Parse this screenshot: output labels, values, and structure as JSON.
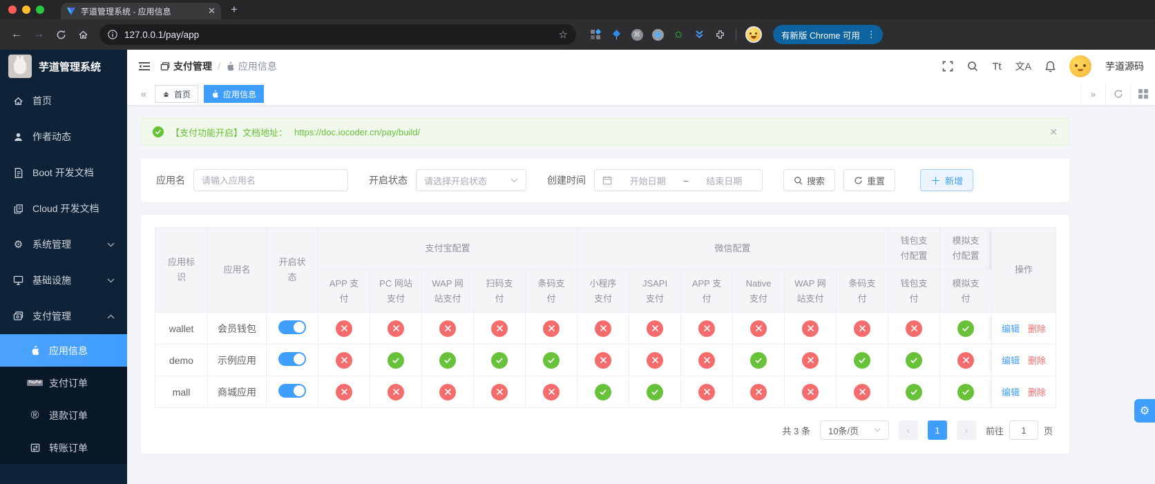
{
  "colors": {
    "accent": "#409eff",
    "success": "#67c23a",
    "danger": "#f56c6c",
    "sidebar_bg": "#0e2238",
    "alert_green_bg": "#f0f9eb"
  },
  "browser": {
    "tab_title": "芋道管理系统 - 应用信息",
    "url": "127.0.0.1/pay/app",
    "update_button": "有新版 Chrome 可用"
  },
  "sidebar": {
    "logo_title": "芋道管理系统",
    "items": [
      {
        "label": "首页"
      },
      {
        "label": "作者动态"
      },
      {
        "label": "Boot 开发文档"
      },
      {
        "label": "Cloud 开发文档"
      },
      {
        "label": "系统管理"
      },
      {
        "label": "基础设施"
      },
      {
        "label": "支付管理"
      }
    ],
    "subitems": [
      {
        "label": "应用信息"
      },
      {
        "label": "支付订单"
      },
      {
        "label": "退款订单"
      },
      {
        "label": "转账订单"
      }
    ]
  },
  "header": {
    "breadcrumb_parent": "支付管理",
    "breadcrumb_current": "应用信息",
    "font_size_icon": "Tt",
    "translate_icon": "文A",
    "user_name": "芋道源码"
  },
  "tabs": {
    "home": "首页",
    "current": "应用信息"
  },
  "alert": {
    "text": "【支付功能开启】文档地址：",
    "link": "https://doc.iocoder.cn/pay/build/"
  },
  "filters": {
    "app_name_label": "应用名",
    "app_name_placeholder": "请输入应用名",
    "status_label": "开启状态",
    "status_placeholder": "请选择开启状态",
    "date_label": "创建时间",
    "date_start_placeholder": "开始日期",
    "date_separator": "–",
    "date_end_placeholder": "结束日期",
    "search_button": "搜索",
    "reset_button": "重置",
    "add_button": "新增"
  },
  "table": {
    "static_columns": [
      "应用标识",
      "应用名",
      "开启状态"
    ],
    "groups": [
      {
        "label": "支付宝配置",
        "columns": [
          "APP 支付",
          "PC 网站支付",
          "WAP 网站支付",
          "扫码支付",
          "条码支付"
        ]
      },
      {
        "label": "微信配置",
        "columns": [
          "小程序支付",
          "JSAPI 支付",
          "APP 支付",
          "Native 支付",
          "WAP 网站支付",
          "条码支付"
        ]
      },
      {
        "label": "钱包支付配置",
        "columns": [
          "钱包支付"
        ]
      },
      {
        "label": "模拟支付配置",
        "columns": [
          "模拟支付"
        ]
      }
    ],
    "action_column": "操作",
    "edit_label": "编辑",
    "delete_label": "删除",
    "rows": [
      {
        "app_id": "wallet",
        "app_name": "会员钱包",
        "enabled": true,
        "channels": [
          false,
          false,
          false,
          false,
          false,
          false,
          false,
          false,
          false,
          false,
          false,
          false,
          true
        ]
      },
      {
        "app_id": "demo",
        "app_name": "示例应用",
        "enabled": true,
        "channels": [
          false,
          true,
          true,
          true,
          true,
          false,
          false,
          false,
          true,
          false,
          true,
          true,
          false
        ]
      },
      {
        "app_id": "mall",
        "app_name": "商城应用",
        "enabled": true,
        "channels": [
          false,
          false,
          false,
          false,
          false,
          true,
          true,
          false,
          false,
          false,
          false,
          true,
          true
        ]
      }
    ]
  },
  "pagination": {
    "total_text": "共 3 条",
    "page_size": "10条/页",
    "current_page": "1",
    "goto_label": "前往",
    "goto_value": "1",
    "page_suffix": "页"
  }
}
